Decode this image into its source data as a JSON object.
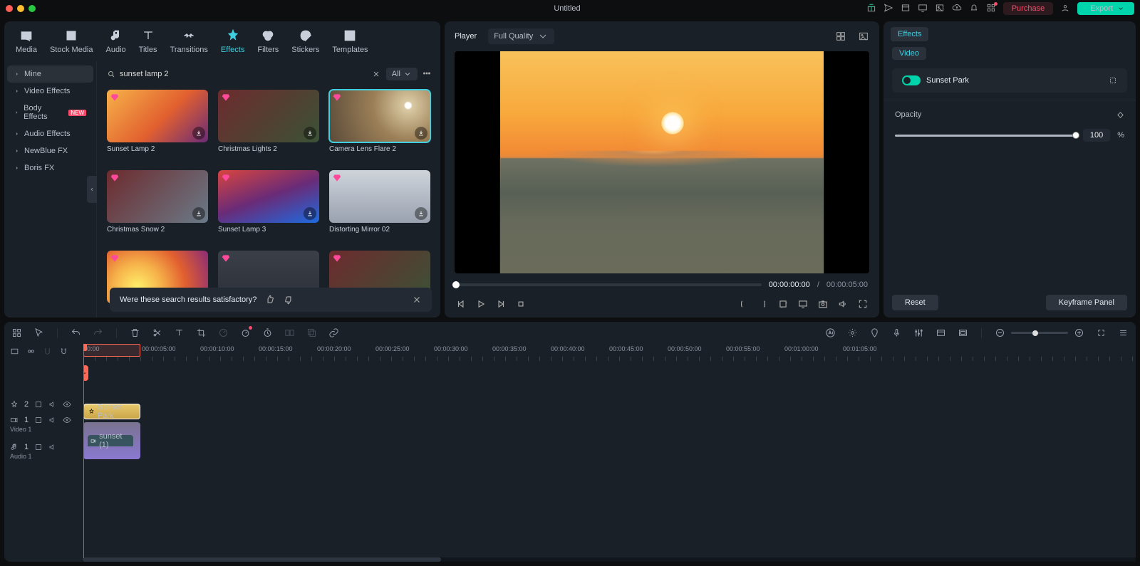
{
  "titlebar": {
    "project": "Untitled",
    "purchase": "Purchase",
    "export": "Export"
  },
  "top_tabs": [
    {
      "label": "Media"
    },
    {
      "label": "Stock Media"
    },
    {
      "label": "Audio"
    },
    {
      "label": "Titles"
    },
    {
      "label": "Transitions"
    },
    {
      "label": "Effects",
      "active": true
    },
    {
      "label": "Filters"
    },
    {
      "label": "Stickers"
    },
    {
      "label": "Templates"
    }
  ],
  "sidebar": {
    "items": [
      {
        "label": "Mine",
        "selected": true
      },
      {
        "label": "Video Effects"
      },
      {
        "label": "Body Effects",
        "badge": "NEW"
      },
      {
        "label": "Audio Effects"
      },
      {
        "label": "NewBlue FX"
      },
      {
        "label": "Boris FX"
      }
    ]
  },
  "search": {
    "value": "sunset lamp 2",
    "scope": "All"
  },
  "cards": [
    {
      "name": "Sunset Lamp 2",
      "bg": "linear-gradient(135deg,#f6b24a 0%,#e2602f 55%,#6a2b77 100%)"
    },
    {
      "name": "Christmas Lights 2",
      "bg": "linear-gradient(135deg,#6d2b2e,#3b5236)"
    },
    {
      "name": "Camera Lens Flare 2",
      "bg": "radial-gradient(circle at 78% 30%,#fff 0 4px,#d9c9a2 6px,#9b7f57 40%,#5a4a39 100%)",
      "selected": true
    },
    {
      "name": "Christmas Snow 2",
      "bg": "linear-gradient(135deg,#6d2b2e,#6a7a88)"
    },
    {
      "name": "Sunset Lamp 3",
      "bg": "linear-gradient(160deg,#d8453f 0%,#6a2b77 50%,#1e6ae0 100%)"
    },
    {
      "name": "Distorting Mirror 02",
      "bg": "linear-gradient(180deg,#cfd4db,#9aa2b0)"
    },
    {
      "name": "",
      "bg": "radial-gradient(circle at 30% 70%,#fff06a 0%,#f6b24a 30%,#e2602f 60%,#8a2b77 100%)"
    },
    {
      "name": "",
      "bg": "linear-gradient(180deg,#3a3f48,#2a2f38)"
    },
    {
      "name": "",
      "bg": "linear-gradient(135deg,#6d2b2e,#3b5236)"
    }
  ],
  "feedback": {
    "question": "Were these search results satisfactory?"
  },
  "player": {
    "label": "Player",
    "quality": "Full Quality",
    "current": "00:00:00:00",
    "sep": "/",
    "total": "00:00:05:00"
  },
  "inspector": {
    "tab": "Effects",
    "subtab": "Video",
    "effect_name": "Sunset Park",
    "prop": "Opacity",
    "value": "100",
    "unit": "%",
    "reset": "Reset",
    "keyframe": "Keyframe Panel"
  },
  "ruler": [
    "00:00",
    "00:00:05:00",
    "00:00:10:00",
    "00:00:15:00",
    "00:00:20:00",
    "00:00:25:00",
    "00:00:30:00",
    "00:00:35:00",
    "00:00:40:00",
    "00:00:45:00",
    "00:00:50:00",
    "00:00:55:00",
    "00:01:00:00",
    "00:01:05:00"
  ],
  "tracks": {
    "fx": {
      "num": "2",
      "clip": "Sunset Park"
    },
    "video": {
      "num": "1",
      "name": "Video 1",
      "clip": "sunset (1)"
    },
    "audio": {
      "num": "1",
      "name": "Audio 1"
    }
  }
}
